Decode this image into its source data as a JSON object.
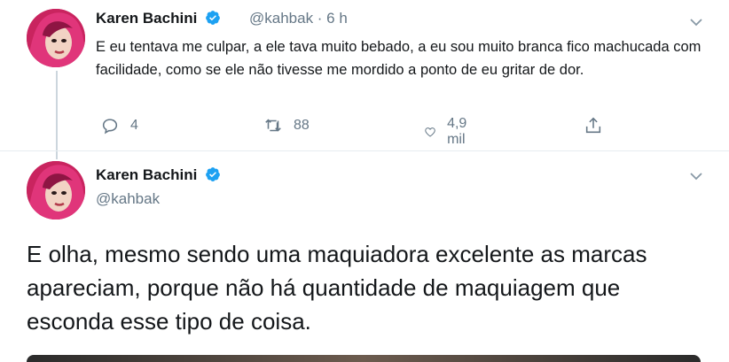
{
  "tweet1": {
    "name": "Karen Bachini",
    "handle_time": "@kahbak · 6 h",
    "text": "E eu tentava me culpar, a ele tava muito bebado, a eu sou muito branca fico machucada com facilidade, como se ele não tivesse me mordido a ponto de eu gritar de dor.",
    "replies": "4",
    "retweets": "88",
    "likes": "4,9 mil"
  },
  "tweet2": {
    "name": "Karen Bachini",
    "handle": "@kahbak",
    "text": "E olha, mesmo sendo uma maquiadora excelente as marcas apareciam, porque não há quantidade de maquiagem que esconda esse tipo de coisa."
  },
  "colors": {
    "verified_blue": "#1da1f2",
    "muted_gray": "#657786",
    "avatar_pink": "#c9245f"
  },
  "icons": [
    "verified-badge-icon",
    "chevron-down-icon",
    "reply-icon",
    "retweet-icon",
    "like-icon",
    "share-icon"
  ]
}
